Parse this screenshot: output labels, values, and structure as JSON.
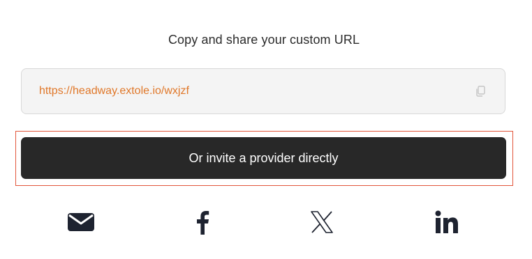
{
  "share": {
    "heading": "Copy and share your custom URL",
    "url": "https://headway.extole.io/wxjzf",
    "copy_icon": "copy-icon",
    "invite_button_label": "Or invite a provider directly",
    "social_icons": [
      "email-icon",
      "facebook-icon",
      "x-icon",
      "linkedin-icon"
    ]
  },
  "colors": {
    "url_text": "#e0782a",
    "button_bg": "#282828",
    "highlight_border": "#e2553b",
    "icon_color": "#1e2330"
  }
}
